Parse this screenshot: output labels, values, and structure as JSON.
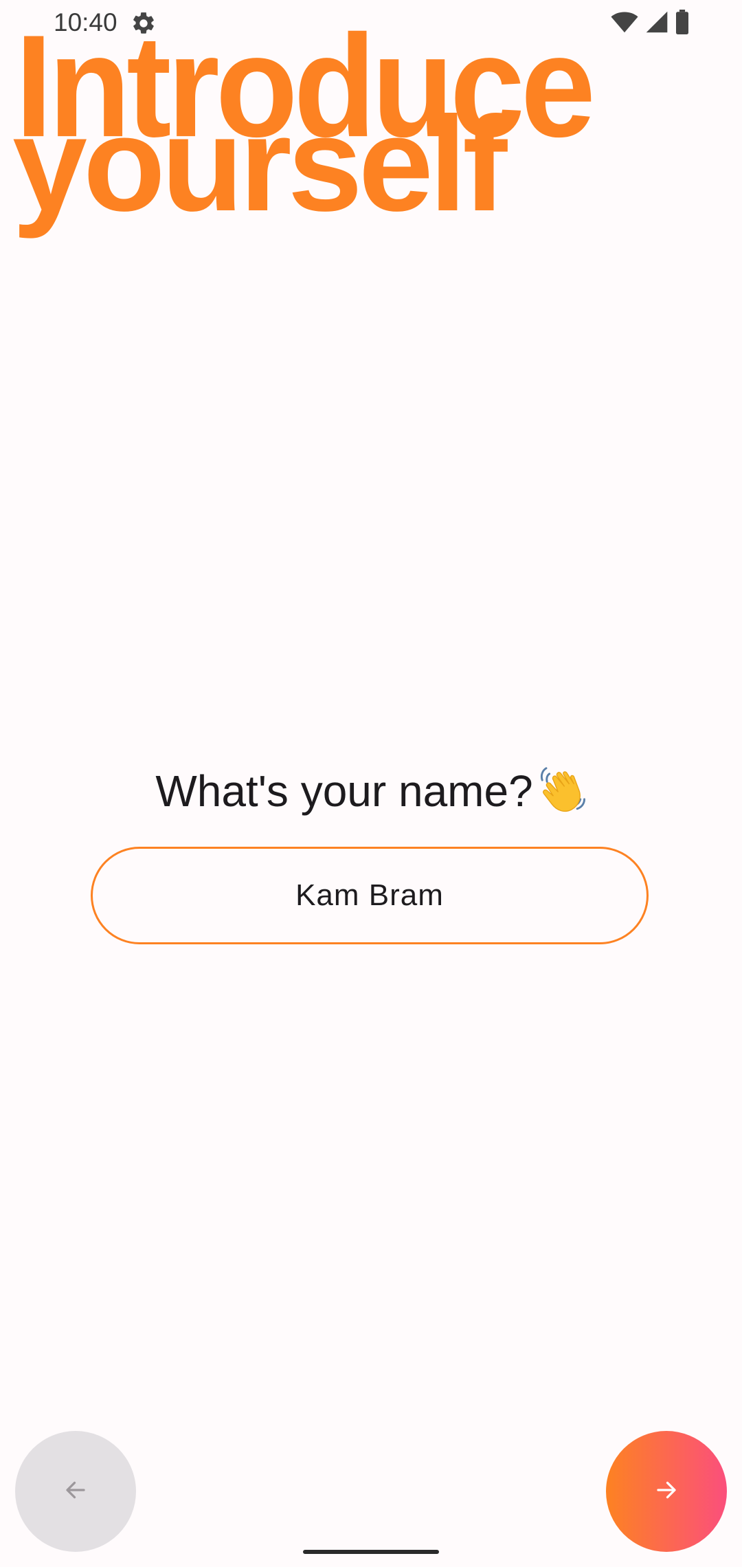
{
  "status_bar": {
    "time": "10:40",
    "icons": [
      "gear-icon",
      "wifi-icon",
      "cell-signal-icon",
      "battery-icon"
    ]
  },
  "header": {
    "title_line1": "Introduce",
    "title_line2": "yourself"
  },
  "form": {
    "question": "What's your name?",
    "question_icon": "waving-hand-icon",
    "name_value": "Kam Bram"
  },
  "navigation": {
    "back_icon": "arrow-left-icon",
    "next_icon": "arrow-right-icon"
  },
  "colors": {
    "accent": "#fd8222",
    "gradient_end": "#fb4f7c",
    "background": "#fffbfc",
    "back_button": "#e3e0e3"
  }
}
